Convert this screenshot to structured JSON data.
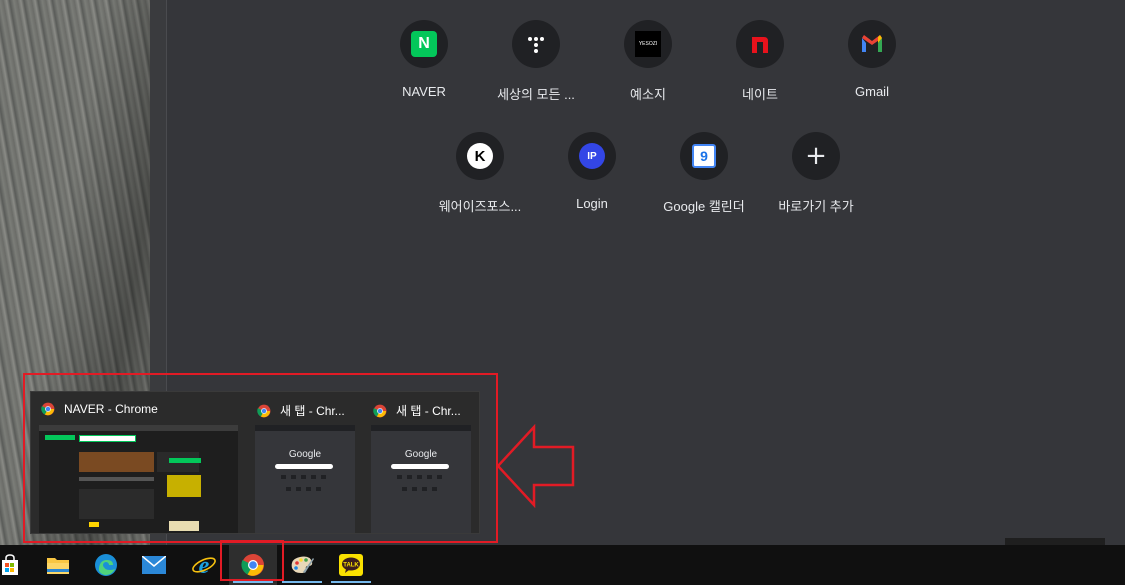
{
  "shortcuts": [
    {
      "label": "NAVER",
      "icon": "naver-icon"
    },
    {
      "label": "세상의 모든 ...",
      "icon": "tstory-icon"
    },
    {
      "label": "예소지",
      "icon": "yesozi-icon",
      "icon_text": "YESOZI"
    },
    {
      "label": "네이트",
      "icon": "nate-icon"
    },
    {
      "label": "Gmail",
      "icon": "gmail-icon"
    },
    {
      "label": "웨어이즈포스...",
      "icon": "k-icon",
      "icon_text": "K"
    },
    {
      "label": "Login",
      "icon": "ip-icon",
      "icon_text": "IP"
    },
    {
      "label": "Google 캘린더",
      "icon": "google-calendar-icon",
      "icon_text": "9"
    },
    {
      "label": "바로가기 추가",
      "icon": "plus-icon",
      "icon_text": "+"
    }
  ],
  "naver_icon_text": "N",
  "preview": {
    "windows": [
      {
        "title": "NAVER - Chrome"
      },
      {
        "title": "새 탭 - Chr..."
      },
      {
        "title": "새 탭 - Chr..."
      }
    ],
    "google_text": "Google"
  },
  "colors": {
    "highlight_red": "#e21b25",
    "chrome_bg": "#35363a",
    "tile_bg": "#202124"
  }
}
